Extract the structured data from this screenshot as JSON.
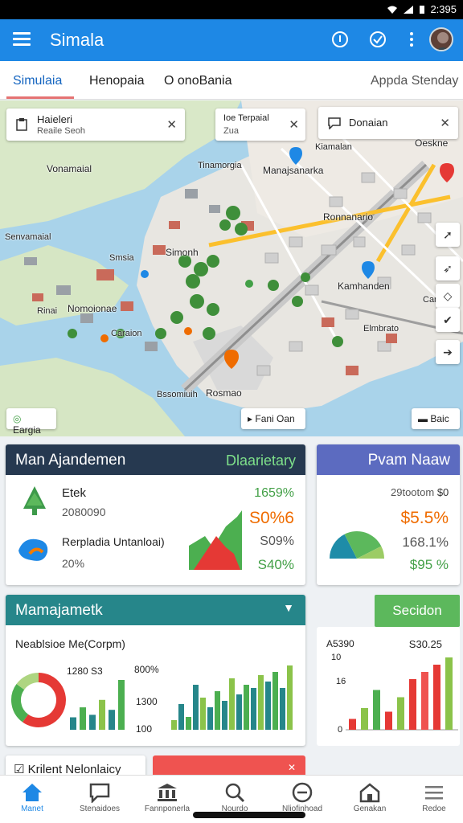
{
  "status": {
    "time": "2:395"
  },
  "appbar": {
    "title": "Simala"
  },
  "tabs": [
    {
      "label": "Simulaia"
    },
    {
      "label": "Henopaia"
    },
    {
      "label": "O onoBania"
    },
    {
      "label": "Appda Stenday"
    }
  ],
  "map": {
    "chips": [
      {
        "title": "Haieleri",
        "sub": "Reaile Seoh"
      },
      {
        "title": "Ioe Terpaial",
        "sub": "Zua"
      },
      {
        "title": "Donaian",
        "sub": ""
      }
    ],
    "labels": [
      "Vonamaial",
      "Tinamorgia",
      "Manajsanarka",
      "Oeskne",
      "Senvamaial",
      "Ronnanario",
      "Smsia",
      "Simonh",
      "Kamhanden",
      "Rinai",
      "Nomoionae",
      "Caraion",
      "Carais",
      "Elmbrato",
      "Bssomiuih",
      "Rosmao",
      "Kiamalan"
    ],
    "bottom_chips": [
      "Eargia",
      "Fani Oan",
      "Baic"
    ]
  },
  "card_main": {
    "title": "Man Ajandemen",
    "badge": "Dlaarietary",
    "row1_label": "Etek",
    "row1_value": "2080090",
    "row2_label": "Rerpladia Untanloai)",
    "row2_value": "20%",
    "metrics": [
      "1659%",
      "S0%6",
      "S09%",
      "S40%"
    ]
  },
  "card_right": {
    "title": "Pvam Naaw",
    "label": "29tootom",
    "label_b": "$0",
    "metrics": [
      "$5.5%",
      "168.1%",
      "$95 %"
    ],
    "pie_data": [
      {
        "name": "teal",
        "value": 35
      },
      {
        "name": "green",
        "value": 50
      },
      {
        "name": "light-green",
        "value": 15
      }
    ]
  },
  "card_mgmt": {
    "title": "Mamajametk",
    "subtitle": "Neablsioe Me(Corpm)",
    "label_a": "1280 S3",
    "label_b": "1300",
    "label_c": "100",
    "label_d": "800%",
    "donut_data": [
      {
        "name": "red",
        "value": 60
      },
      {
        "name": "green",
        "value": 25
      },
      {
        "name": "light",
        "value": 15
      }
    ],
    "bars_small": [
      5,
      9,
      6,
      12,
      8,
      20
    ],
    "bars_large": [
      3,
      8,
      4,
      14,
      10,
      7,
      12,
      9,
      16,
      11,
      14,
      13,
      17,
      15,
      18,
      13,
      20
    ]
  },
  "card_section": {
    "button": "Secidon",
    "top_left": "A5390",
    "top_right": "S30.25",
    "axis_labels": [
      "10",
      "16",
      "0"
    ],
    "bars": [
      {
        "v": 3,
        "c": "#e53935"
      },
      {
        "v": 6,
        "c": "#8bc34a"
      },
      {
        "v": 11,
        "c": "#4caf50"
      },
      {
        "v": 5,
        "c": "#e53935"
      },
      {
        "v": 9,
        "c": "#8bc34a"
      },
      {
        "v": 14,
        "c": "#e53935"
      },
      {
        "v": 16,
        "c": "#ef5350"
      },
      {
        "v": 18,
        "c": "#e53935"
      },
      {
        "v": 20,
        "c": "#8bc34a"
      }
    ]
  },
  "card_partial": {
    "title": "Krilent Nelonlaicy"
  },
  "nav": [
    {
      "label": "Manet"
    },
    {
      "label": "Stenaidoes"
    },
    {
      "label": "Fannponerla"
    },
    {
      "label": "Nourdo"
    },
    {
      "label": "Nliofinhoad"
    },
    {
      "label": "Genakan"
    },
    {
      "label": "Redoe"
    }
  ],
  "colors": {
    "primary": "#1e88e5",
    "card_dark": "#263950",
    "card_purple": "#5c6bc0",
    "card_teal": "#26868a",
    "green_btn": "#5cb85c",
    "accent_red": "#e57373"
  }
}
